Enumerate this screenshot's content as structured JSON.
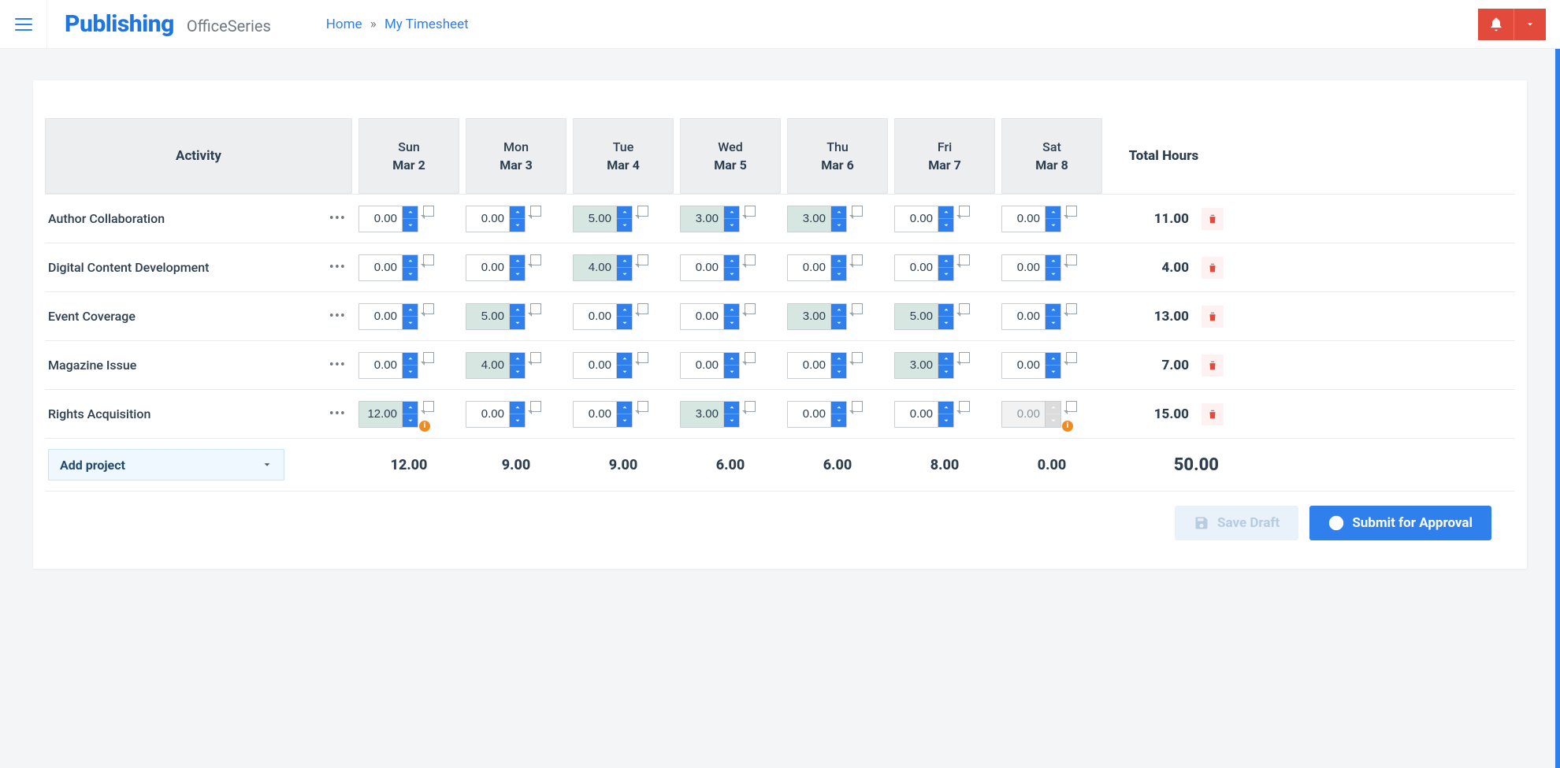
{
  "header": {
    "brand_main": "Publishing",
    "brand_sub": "OfficeSeries",
    "breadcrumb_home": "Home",
    "breadcrumb_current": "My Timesheet"
  },
  "table": {
    "activity_header": "Activity",
    "total_header": "Total Hours",
    "days": [
      {
        "day": "Sun",
        "date": "Mar 2"
      },
      {
        "day": "Mon",
        "date": "Mar 3"
      },
      {
        "day": "Tue",
        "date": "Mar 4"
      },
      {
        "day": "Wed",
        "date": "Mar 5"
      },
      {
        "day": "Thu",
        "date": "Mar 6"
      },
      {
        "day": "Fri",
        "date": "Mar 7"
      },
      {
        "day": "Sat",
        "date": "Mar 8"
      }
    ],
    "rows": [
      {
        "name": "Author Collaboration",
        "hours": [
          "0.00",
          "0.00",
          "5.00",
          "3.00",
          "3.00",
          "0.00",
          "0.00"
        ],
        "filled": [
          false,
          false,
          true,
          true,
          true,
          false,
          false
        ],
        "disabled": [
          false,
          false,
          false,
          false,
          false,
          false,
          false
        ],
        "warn": [
          false,
          false,
          false,
          false,
          false,
          false,
          false
        ],
        "total": "11.00"
      },
      {
        "name": "Digital Content Development",
        "hours": [
          "0.00",
          "0.00",
          "4.00",
          "0.00",
          "0.00",
          "0.00",
          "0.00"
        ],
        "filled": [
          false,
          false,
          true,
          false,
          false,
          false,
          false
        ],
        "disabled": [
          false,
          false,
          false,
          false,
          false,
          false,
          false
        ],
        "warn": [
          false,
          false,
          false,
          false,
          false,
          false,
          false
        ],
        "total": "4.00"
      },
      {
        "name": "Event Coverage",
        "hours": [
          "0.00",
          "5.00",
          "0.00",
          "0.00",
          "3.00",
          "5.00",
          "0.00"
        ],
        "filled": [
          false,
          true,
          false,
          false,
          true,
          true,
          false
        ],
        "disabled": [
          false,
          false,
          false,
          false,
          false,
          false,
          false
        ],
        "warn": [
          false,
          false,
          false,
          false,
          false,
          false,
          false
        ],
        "total": "13.00"
      },
      {
        "name": "Magazine Issue",
        "hours": [
          "0.00",
          "4.00",
          "0.00",
          "0.00",
          "0.00",
          "3.00",
          "0.00"
        ],
        "filled": [
          false,
          true,
          false,
          false,
          false,
          true,
          false
        ],
        "disabled": [
          false,
          false,
          false,
          false,
          false,
          false,
          false
        ],
        "warn": [
          false,
          false,
          false,
          false,
          false,
          false,
          false
        ],
        "total": "7.00"
      },
      {
        "name": "Rights Acquisition",
        "hours": [
          "12.00",
          "0.00",
          "0.00",
          "3.00",
          "0.00",
          "0.00",
          "0.00"
        ],
        "filled": [
          true,
          false,
          false,
          true,
          false,
          false,
          false
        ],
        "disabled": [
          false,
          false,
          false,
          false,
          false,
          false,
          true
        ],
        "warn": [
          true,
          false,
          false,
          false,
          false,
          false,
          true
        ],
        "total": "15.00"
      }
    ],
    "add_project_label": "Add project",
    "day_totals": [
      "12.00",
      "9.00",
      "9.00",
      "6.00",
      "6.00",
      "8.00",
      "0.00"
    ],
    "grand_total": "50.00"
  },
  "actions": {
    "save_label": "Save Draft",
    "submit_label": "Submit for Approval"
  }
}
